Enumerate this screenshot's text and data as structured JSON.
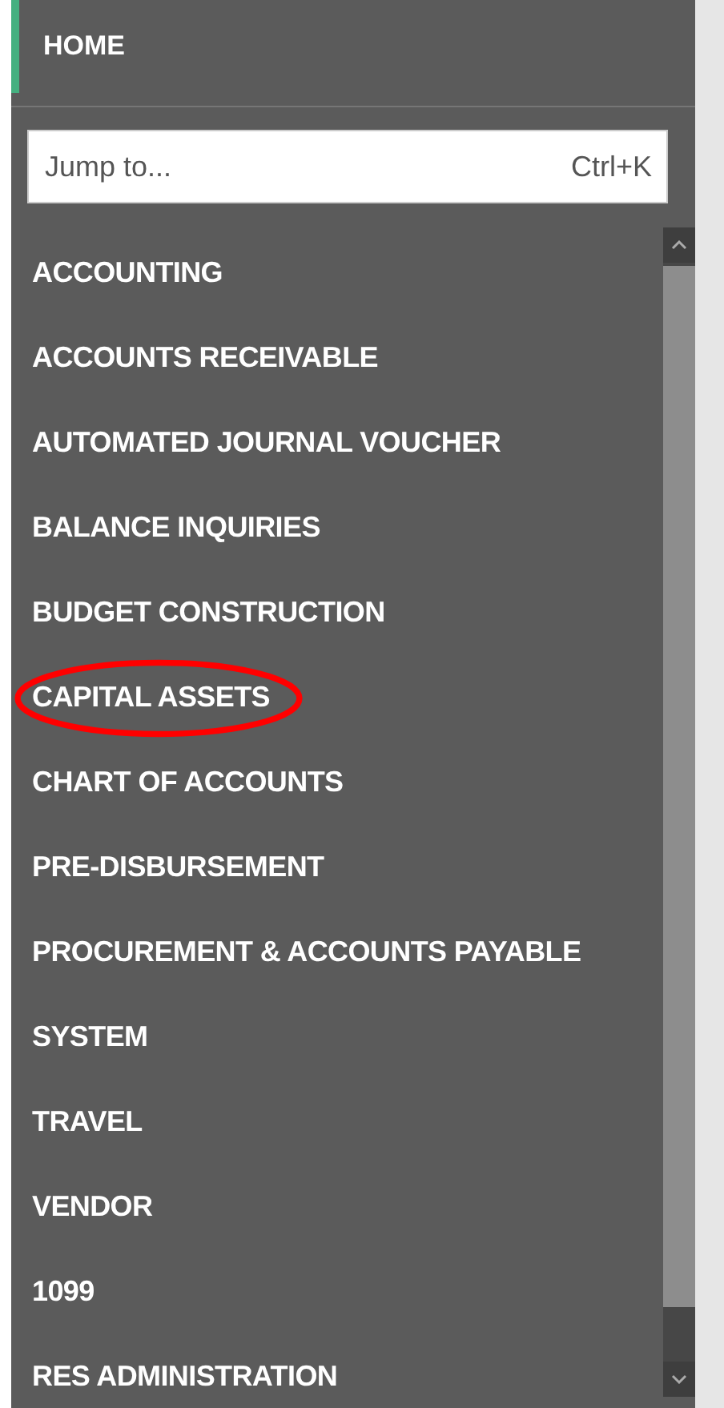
{
  "home": {
    "label": "HOME",
    "selected": true
  },
  "search": {
    "placeholder": "Jump to...",
    "shortcut": "Ctrl+K"
  },
  "menu": [
    {
      "label": "ACCOUNTING",
      "circled": false
    },
    {
      "label": "ACCOUNTS RECEIVABLE",
      "circled": false
    },
    {
      "label": "AUTOMATED JOURNAL VOUCHER",
      "circled": false
    },
    {
      "label": "BALANCE INQUIRIES",
      "circled": false
    },
    {
      "label": "BUDGET CONSTRUCTION",
      "circled": false
    },
    {
      "label": "CAPITAL ASSETS",
      "circled": true
    },
    {
      "label": "CHART OF ACCOUNTS",
      "circled": false
    },
    {
      "label": "PRE-DISBURSEMENT",
      "circled": false
    },
    {
      "label": "PROCUREMENT & ACCOUNTS PAYABLE",
      "circled": false
    },
    {
      "label": "SYSTEM",
      "circled": false
    },
    {
      "label": "TRAVEL",
      "circled": false
    },
    {
      "label": "VENDOR",
      "circled": false
    },
    {
      "label": "1099",
      "circled": false
    },
    {
      "label": "RES ADMINISTRATION",
      "circled": false
    }
  ]
}
